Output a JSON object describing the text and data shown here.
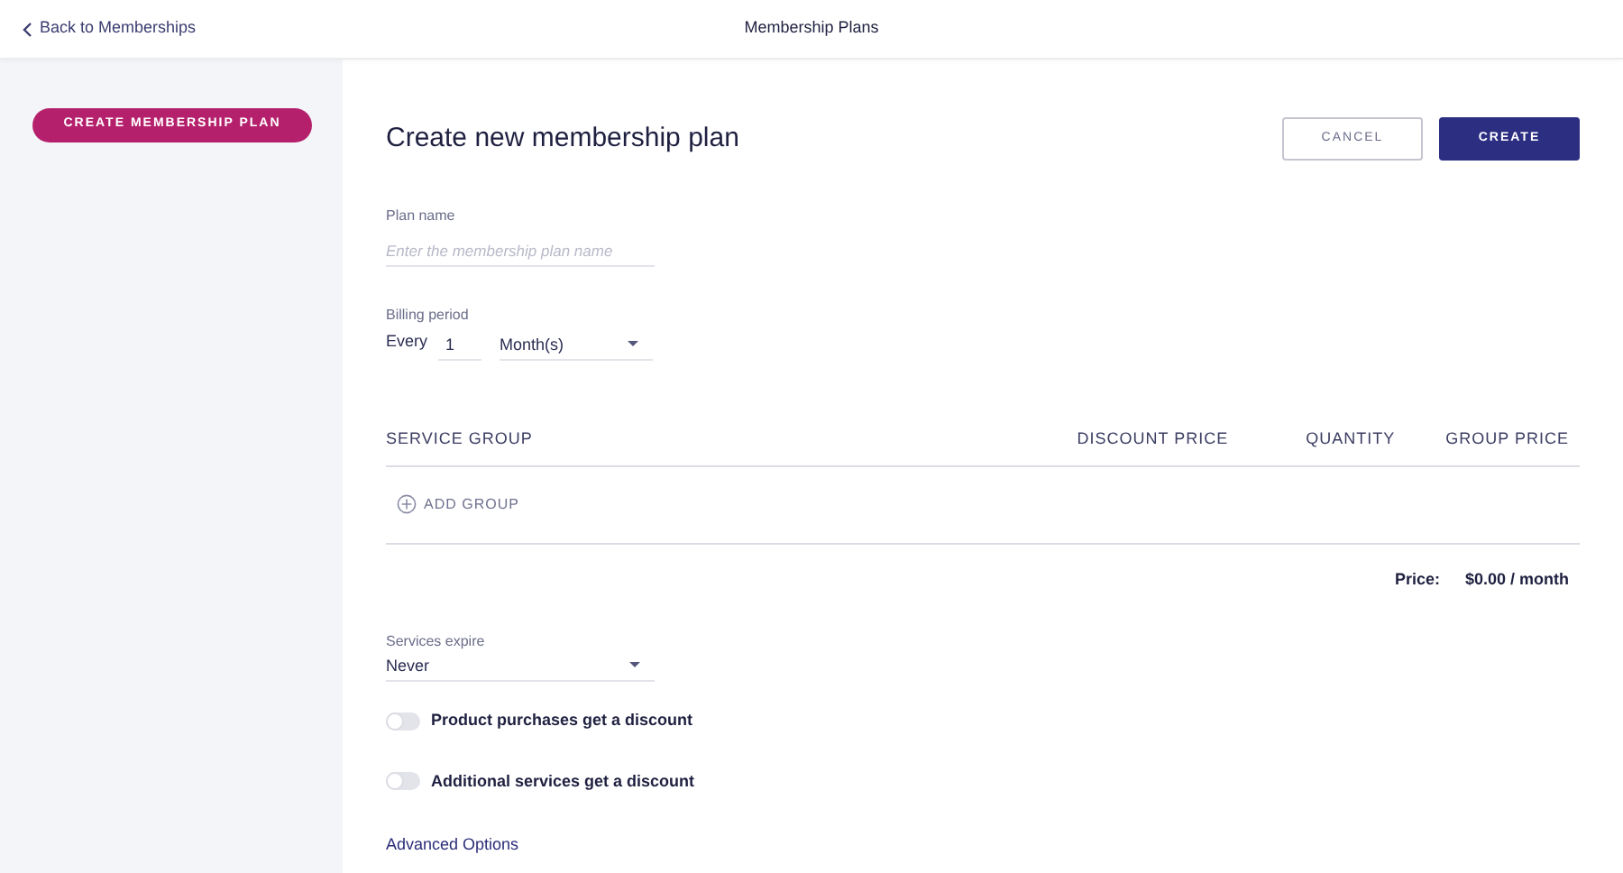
{
  "header": {
    "back_link": "Back to Memberships",
    "title": "Membership Plans"
  },
  "sidebar": {
    "create_button": "CREATE MEMBERSHIP PLAN"
  },
  "form": {
    "heading": "Create new membership plan",
    "buttons": [
      {
        "label": "CANCEL",
        "kind": "secondary"
      },
      {
        "label": "CREATE",
        "kind": "primary"
      }
    ],
    "plan_name": {
      "label": "Plan name",
      "placeholder": "Enter the membership plan name"
    },
    "billing_period": {
      "label": "Billing period",
      "prefix": "Every",
      "count": "1",
      "unit": "Month(s)"
    },
    "table": {
      "columns": [
        "SERVICE GROUP",
        "DISCOUNT PRICE",
        "QUANTITY",
        "GROUP PRICE"
      ],
      "add_group": "ADD GROUP",
      "price_label": "Price:",
      "price_value": "$0.00 / month"
    },
    "services_expire": {
      "label": "Services expire",
      "value": "Never"
    },
    "toggles": [
      {
        "label": "Product purchases get a discount",
        "on": false
      },
      {
        "label": "Additional services get a discount",
        "on": false
      }
    ],
    "advanced_link": "Advanced Options"
  }
}
